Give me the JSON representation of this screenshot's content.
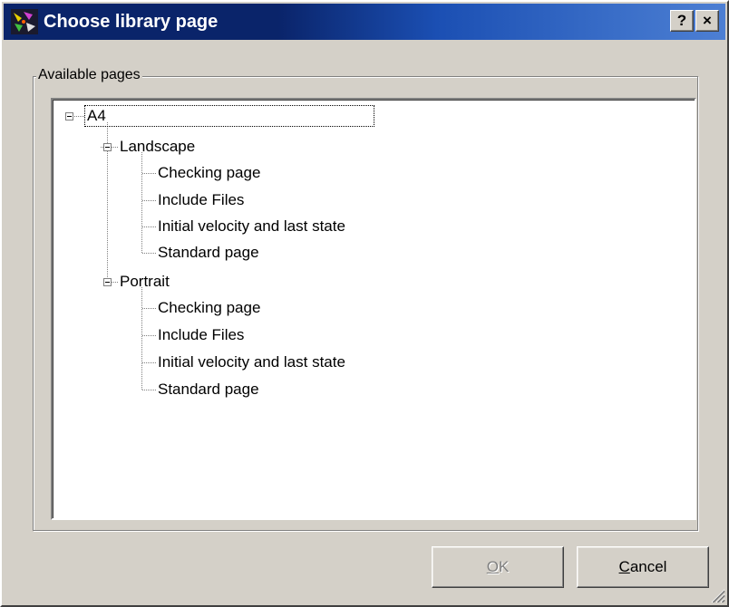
{
  "window": {
    "title": "Choose library page",
    "help_button": "?",
    "close_button": "×"
  },
  "group": {
    "label": "Available pages"
  },
  "tree": {
    "root": {
      "label": "A4",
      "expanded": true,
      "selected": true,
      "children": [
        {
          "label": "Landscape",
          "expanded": true,
          "children": [
            "Checking page",
            "Include Files",
            "Initial velocity and last state",
            "Standard page"
          ]
        },
        {
          "label": "Portrait",
          "expanded": true,
          "children": [
            "Checking page",
            "Include Files",
            "Initial velocity and last state",
            "Standard page"
          ]
        }
      ]
    }
  },
  "buttons": {
    "ok": {
      "mnemonic": "O",
      "rest": "K",
      "enabled": false
    },
    "cancel": {
      "mnemonic": "C",
      "rest": "ancel",
      "enabled": true
    }
  },
  "colors": {
    "titlebar_start": "#0a246a",
    "titlebar_end": "#4d7fd3",
    "face": "#d4d0c8",
    "disabled_text": "#808080"
  }
}
